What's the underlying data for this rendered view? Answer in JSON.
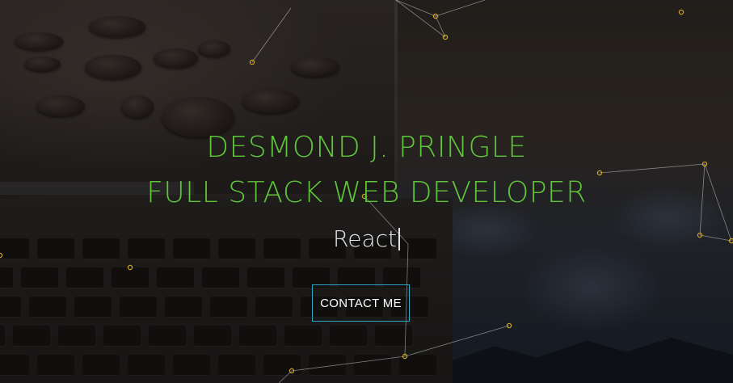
{
  "hero": {
    "name": "DESMOND J. PRINGLE",
    "role": "FULL STACK WEB DEVELOPER",
    "typed_text": "React",
    "contact_label": "CONTACT ME"
  },
  "colors": {
    "headline": "#5fc33b",
    "button_border": "#2aa7c9",
    "node": "#c9a227",
    "line": "#d9d9d9"
  }
}
